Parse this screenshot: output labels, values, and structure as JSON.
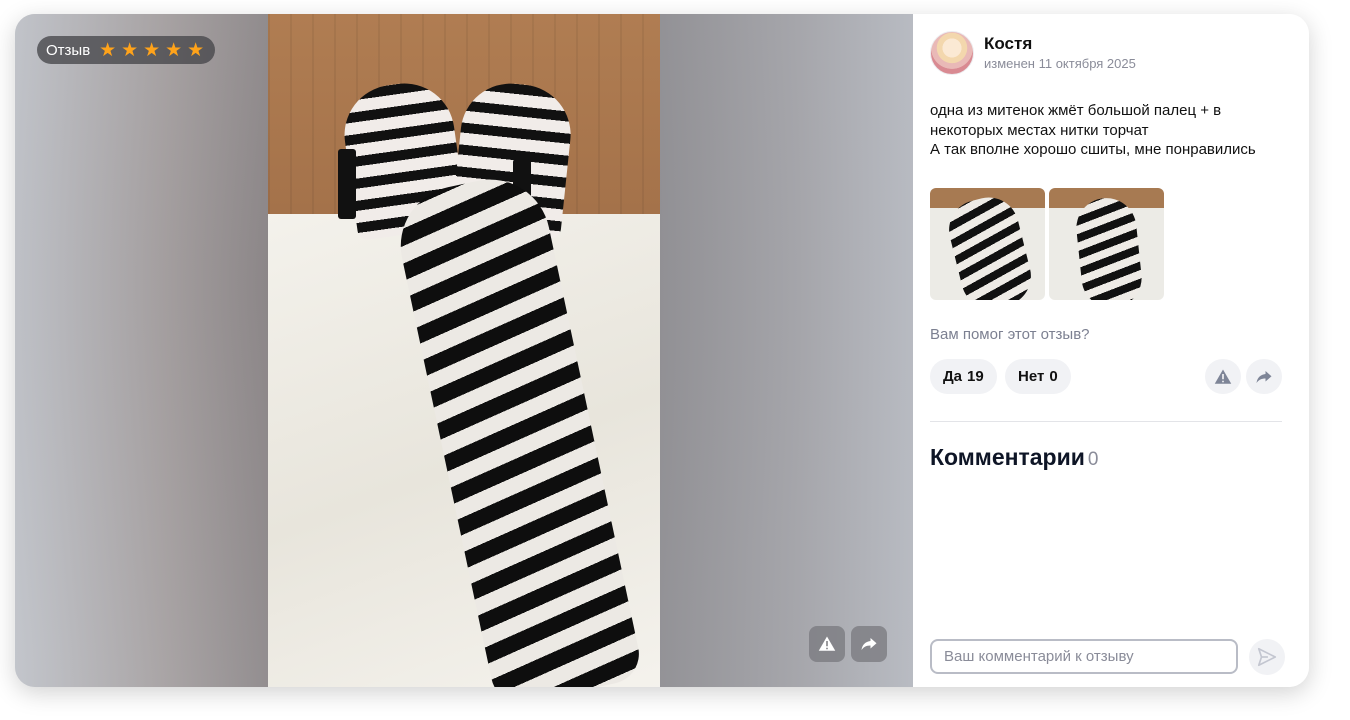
{
  "badge": {
    "label": "Отзыв",
    "rating": 5
  },
  "author": {
    "name": "Костя",
    "date": "изменен 11 октября 2025"
  },
  "review": {
    "lines": [
      "одна из митенок жмёт большой палец + в",
      "некоторых местах нитки торчат",
      "А так вполне хорошо сшиты, мне понравились"
    ]
  },
  "helpful": {
    "question": "Вам помог этот отзыв?",
    "yes_label": "Да",
    "yes_count": "19",
    "no_label": "Нет",
    "no_count": "0"
  },
  "comments": {
    "title": "Комментарии",
    "count": "0",
    "placeholder": "Ваш комментарий к отзыву"
  },
  "icons": {
    "star": "star-icon",
    "warning": "warning-icon",
    "share": "share-icon",
    "send": "send-icon"
  },
  "colors": {
    "star": "#ffa31a",
    "accent_text": "#0e1526",
    "muted": "#8a8c99"
  }
}
